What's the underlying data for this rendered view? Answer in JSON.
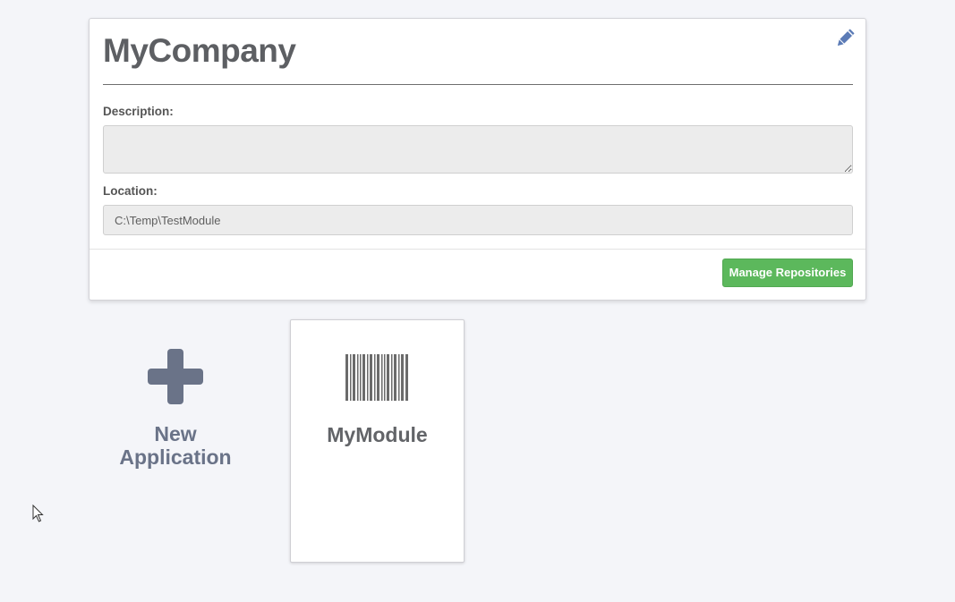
{
  "company": {
    "name": "MyCompany",
    "edit_icon": "pencil-icon",
    "description_label": "Description:",
    "description_value": "",
    "location_label": "Location:",
    "location_value": "C:\\Temp\\TestModule",
    "manage_button": "Manage Repositories"
  },
  "new_application": {
    "icon": "plus-icon",
    "line1": "New",
    "line2": "Application"
  },
  "modules": [
    {
      "name": "MyModule",
      "icon": "barcode-icon"
    }
  ],
  "colors": {
    "background": "#f4f5f9",
    "accent_green": "#5cb85c",
    "edit_icon_blue": "#5b7bb6",
    "slate": "#6a7388",
    "title_gray": "#5d5f63"
  }
}
